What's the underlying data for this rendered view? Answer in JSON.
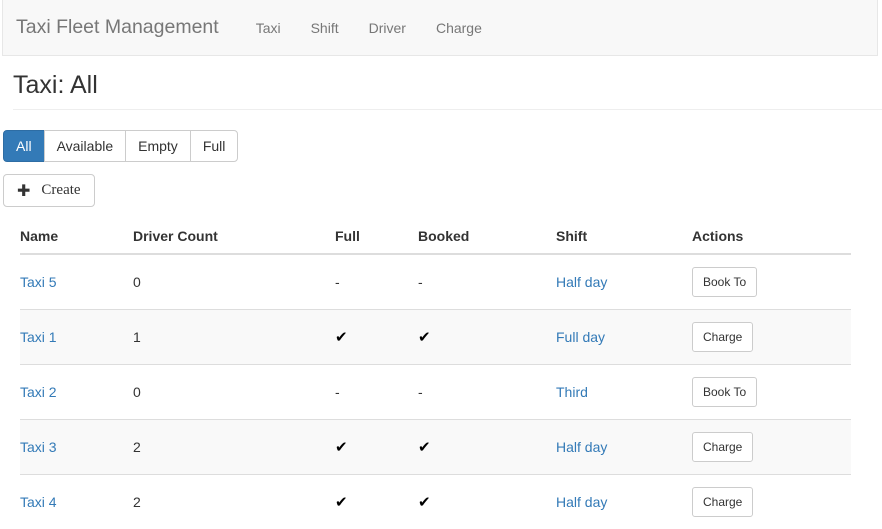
{
  "navbar": {
    "brand": "Taxi Fleet Management",
    "links": [
      {
        "label": "Taxi"
      },
      {
        "label": "Shift"
      },
      {
        "label": "Driver"
      },
      {
        "label": "Charge"
      }
    ]
  },
  "page": {
    "title": "Taxi: All"
  },
  "filters": {
    "items": [
      {
        "label": "All",
        "active": true
      },
      {
        "label": "Available",
        "active": false
      },
      {
        "label": "Empty",
        "active": false
      },
      {
        "label": "Full",
        "active": false
      }
    ]
  },
  "toolbar": {
    "create_label": "Create",
    "create_icon": "plus-icon",
    "plus_glyph": "➕"
  },
  "table": {
    "columns": [
      {
        "key": "name",
        "label": "Name"
      },
      {
        "key": "driver_count",
        "label": "Driver Count"
      },
      {
        "key": "full",
        "label": "Full"
      },
      {
        "key": "booked",
        "label": "Booked"
      },
      {
        "key": "shift",
        "label": "Shift"
      },
      {
        "key": "actions",
        "label": "Actions"
      }
    ],
    "check_glyph": "✔",
    "dash_glyph": "-",
    "rows": [
      {
        "name": "Taxi 5",
        "driver_count": "0",
        "full": "-",
        "booked": "-",
        "shift": "Half day",
        "action_label": "Book To",
        "striped": false
      },
      {
        "name": "Taxi 1",
        "driver_count": "1",
        "full": "✔",
        "booked": "✔",
        "shift": "Full day",
        "action_label": "Charge",
        "striped": true
      },
      {
        "name": "Taxi 2",
        "driver_count": "0",
        "full": "-",
        "booked": "-",
        "shift": "Third",
        "action_label": "Book To",
        "striped": false
      },
      {
        "name": "Taxi 3",
        "driver_count": "2",
        "full": "✔",
        "booked": "✔",
        "shift": "Half day",
        "action_label": "Charge",
        "striped": true
      },
      {
        "name": "Taxi 4",
        "driver_count": "2",
        "full": "✔",
        "booked": "✔",
        "shift": "Half day",
        "action_label": "Charge",
        "striped": false
      }
    ]
  },
  "colors": {
    "link": "#337ab7",
    "active_button": "#337ab7",
    "navbar_bg": "#f8f8f8",
    "muted_text": "#777777",
    "stripe": "#f9f9f9"
  }
}
